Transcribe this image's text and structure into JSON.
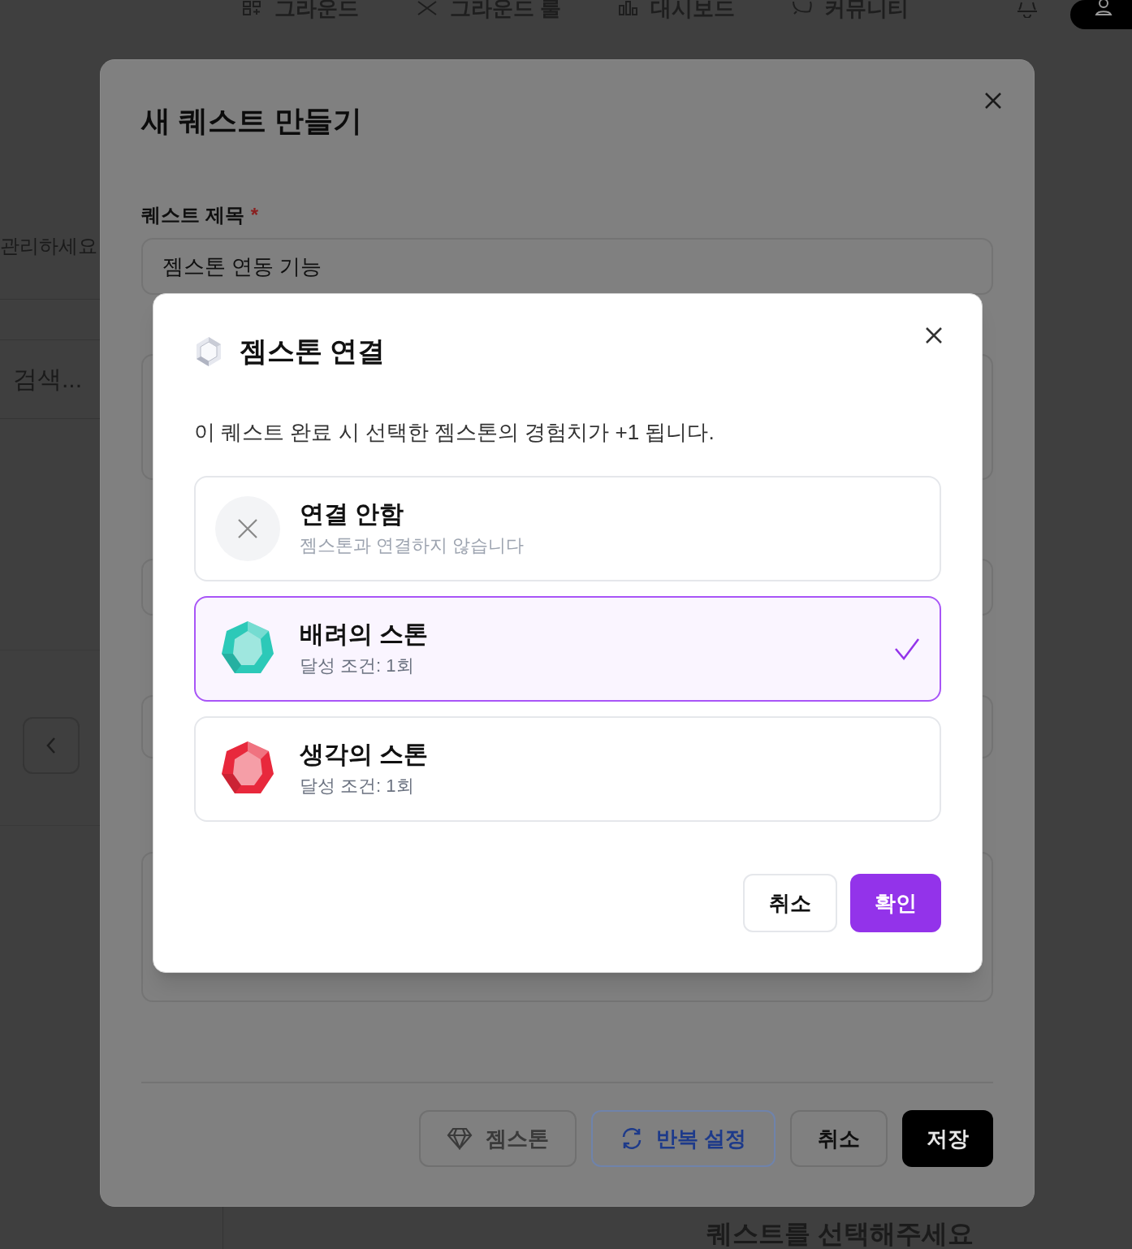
{
  "nav": [
    {
      "label": "그라운드",
      "kind": "ground"
    },
    {
      "label": "그라운드 룰",
      "kind": "rules"
    },
    {
      "label": "대시보드",
      "kind": "dashboard"
    },
    {
      "label": "커뮤니티",
      "kind": "community"
    }
  ],
  "background": {
    "subtitle_fragment": "관리하세요",
    "search_fragment": "검색...",
    "footer_text": "퀘스트를 선택해주세요"
  },
  "quest_dialog": {
    "title": "새 퀘스트 만들기",
    "fields": [
      {
        "label": "퀘스트 제목",
        "required_mark": "*",
        "kind": "input",
        "value": "젬스톤 연동 기능"
      },
      {
        "kind": "textarea"
      },
      {
        "kind": "input"
      },
      {
        "kind": "input"
      },
      {
        "kind": "textarea"
      }
    ],
    "buttons": [
      {
        "label": "젬스톤",
        "kind": "gem"
      },
      {
        "label": "반복 설정",
        "kind": "repeat"
      },
      {
        "label": "취소",
        "kind": "cancel"
      },
      {
        "label": "저장",
        "kind": "save"
      }
    ]
  },
  "gem_dialog": {
    "title": "젬스톤 연결",
    "description": "이 퀘스트 완료 시 선택한 젬스톤의 경험치가 +1 됩니다.",
    "options": [
      {
        "kind": "none",
        "title": "연결 안함",
        "subtitle": "젬스톤과 연결하지 않습니다",
        "selected": false
      },
      {
        "kind": "gem",
        "title": "배려의 스톤",
        "subtitle": "달성 조건: 1회",
        "color": "#2cc9b8",
        "selected": true
      },
      {
        "kind": "gem",
        "title": "생각의 스톤",
        "subtitle": "달성 조건: 1회",
        "color": "#e8283c",
        "selected": false
      }
    ],
    "buttons": [
      {
        "label": "취소",
        "kind": "cancel"
      },
      {
        "label": "확인",
        "kind": "confirm"
      }
    ]
  }
}
